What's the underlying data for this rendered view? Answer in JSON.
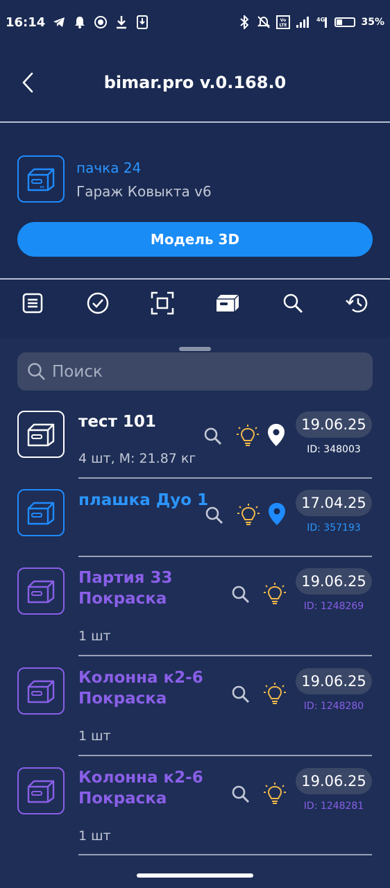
{
  "status_bar": {
    "time": "16:14",
    "battery": "35%",
    "battery_level": 0.35,
    "left_icons": [
      "telegram-icon",
      "bell-icon",
      "record-icon",
      "download-icon",
      "download-box-icon"
    ],
    "right_icons": [
      "bluetooth-icon",
      "mute-icon",
      "volte-icon",
      "signal-icon",
      "4g-icon",
      "battery-icon"
    ]
  },
  "header": {
    "title": "bimar.pro v.0.168.0",
    "back_icon": "chevron-left-icon"
  },
  "box": {
    "name": "пачка 24",
    "subtitle": "Гараж Ковыкта v6",
    "icon": "box-icon"
  },
  "model_button": "Модель 3D",
  "tabs": [
    {
      "name": "list-tab",
      "icon": "list-icon",
      "active": false
    },
    {
      "name": "check-tab",
      "icon": "check-circle-icon",
      "active": false
    },
    {
      "name": "scan-tab",
      "icon": "scan-icon",
      "active": false
    },
    {
      "name": "box-tab",
      "icon": "box-icon",
      "active": true
    },
    {
      "name": "search-tab",
      "icon": "search-icon",
      "active": false
    },
    {
      "name": "history-tab",
      "icon": "history-icon",
      "active": false
    }
  ],
  "search": {
    "placeholder": "Поиск"
  },
  "colors": {
    "background": "#1a2a52",
    "accent_blue": "#1f8bff",
    "purple": "#8a5fe8",
    "bulb": "#f2b84b",
    "white": "#ffffff"
  },
  "items": [
    {
      "title": "тест 101",
      "subtitle": "4 шт, М: 21.87 кг",
      "date": "19.06.25",
      "id": "ID: 348003",
      "color": "#ffffff",
      "has_pin": true,
      "pin_color": "#ffffff"
    },
    {
      "title": "плашка Дуо 1",
      "subtitle": "",
      "date": "17.04.25",
      "id": "ID: 357193",
      "color": "#2b95ff",
      "has_pin": true,
      "pin_color": "#1f8bff"
    },
    {
      "title_line1": "Партия 33",
      "title_line2": "Покраска",
      "subtitle": "1 шт",
      "date": "19.06.25",
      "id": "ID: 1248269",
      "color": "#8a5fe8",
      "has_pin": false
    },
    {
      "title_line1": "Колонна к2-6",
      "title_line2": "Покраска",
      "subtitle": "1 шт",
      "date": "19.06.25",
      "id": "ID: 1248280",
      "color": "#8a5fe8",
      "has_pin": false
    },
    {
      "title_line1": "Колонна к2-6",
      "title_line2": "Покраска",
      "subtitle": "1 шт",
      "date": "19.06.25",
      "id": "ID: 1248281",
      "color": "#8a5fe8",
      "has_pin": false
    }
  ]
}
